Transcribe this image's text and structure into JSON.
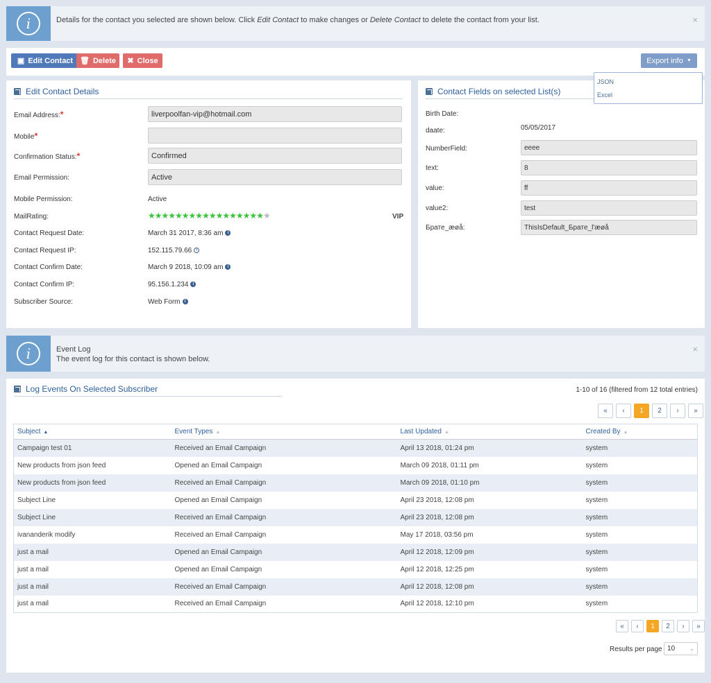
{
  "top_alert": {
    "text_1": "Details for the contact you selected are shown below. Click ",
    "em_1": "Edit Contact",
    "text_2": " to make changes or ",
    "em_2": "Delete Contact",
    "text_3": " to delete the contact from your list.",
    "close": "×"
  },
  "toolbar": {
    "edit": "Edit Contact",
    "delete": "Delete",
    "close": "Close",
    "export": "Export info",
    "export_options": [
      "JSON",
      "Excel"
    ]
  },
  "details": {
    "title": "Edit Contact Details",
    "fields": [
      {
        "label": "Email Address:",
        "value": "liverpoolfan-vip@hotmail.com"
      },
      {
        "label": "Mobile",
        "value": ""
      },
      {
        "label": "Confirmation Status:",
        "value": "Confirmed"
      },
      {
        "label": "Email Permission:",
        "value": "Active"
      }
    ],
    "static": [
      {
        "label": "Mobile Permission:",
        "value": "Active"
      },
      {
        "label": "MailRating:",
        "value": ""
      },
      {
        "label": "Contact Request Date:",
        "value": "March 31 2017, 8:36 am"
      },
      {
        "label": "Contact Request IP:",
        "value": "152.115.79.66"
      },
      {
        "label": "Contact Confirm Date:",
        "value": "March 9 2018, 10:09 am"
      },
      {
        "label": "Contact Confirm IP:",
        "value": "95.156.1.234"
      },
      {
        "label": "Subscriber Source:",
        "value": "Web Form"
      }
    ],
    "rating_filled": 17,
    "rating_total": 18,
    "rating_badge": "VIP"
  },
  "contact_fields": {
    "title": "Contact Fields on selected List(s)",
    "fields": [
      {
        "label": "Birth Date:",
        "value": ""
      },
      {
        "label": "daate:",
        "value": "05/05/2017"
      },
      {
        "label": "NumberField:",
        "value": "eeee"
      },
      {
        "label": "text:",
        "value": "8"
      },
      {
        "label": "value:",
        "value": "ff"
      },
      {
        "label": "value2:",
        "value": "test"
      },
      {
        "label": "Братe_æøå:",
        "value": "ThisIsDefault_Братe_l'æøå"
      }
    ]
  },
  "event_alert": {
    "title": "Event Log",
    "text": "The event log for this contact is shown below.",
    "close": "×"
  },
  "log": {
    "title": "Log Events On Selected Subscriber",
    "summary": "1-10 of 16 (filtered from 12 total entries)",
    "columns": [
      "Subject",
      "Event Types",
      "Last Updated",
      "Created By"
    ],
    "rows": [
      [
        "Campaign test 01",
        "Received an Email Campaign",
        "April 13 2018, 01:24 pm",
        "system"
      ],
      [
        "New products from json feed",
        "Opened an Email Campaign",
        "March 09 2018, 01:11 pm",
        "system"
      ],
      [
        "New products from json feed",
        "Received an Email Campaign",
        "March 09 2018, 01:10 pm",
        "system"
      ],
      [
        "Subject Line",
        "Opened an Email Campaign",
        "April 23 2018, 12:08 pm",
        "system"
      ],
      [
        "Subject Line",
        "Received an Email Campaign",
        "April 23 2018, 12:08 pm",
        "system"
      ],
      [
        "ivananderik modify",
        "Received an Email Campaign",
        "May 17 2018, 03:56 pm",
        "system"
      ],
      [
        "just a mail",
        "Opened an Email Campaign",
        "April 12 2018, 12:09 pm",
        "system"
      ],
      [
        "just a mail",
        "Opened an Email Campaign",
        "April 12 2018, 12:25 pm",
        "system"
      ],
      [
        "just a mail",
        "Received an Email Campaign",
        "April 12 2018, 12:08 pm",
        "system"
      ],
      [
        "just a mail",
        "Received an Email Campaign",
        "April 12 2018, 12:10 pm",
        "system"
      ]
    ],
    "pager": [
      "«",
      "‹",
      "1",
      "2",
      "›",
      "»"
    ],
    "results_label": "Results per page",
    "results_value": "10"
  }
}
